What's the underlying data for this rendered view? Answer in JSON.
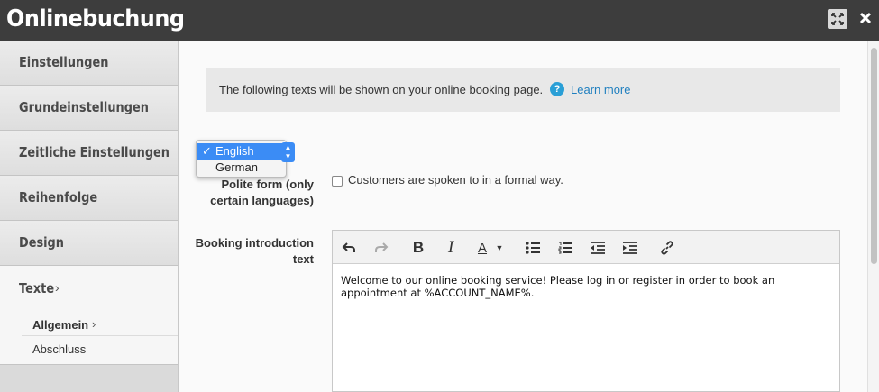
{
  "window": {
    "title": "Onlinebuchung"
  },
  "sidebar": {
    "items": [
      {
        "label": "Einstellungen"
      },
      {
        "label": "Grundeinstellungen"
      },
      {
        "label": "Zeitliche Einstellungen"
      },
      {
        "label": "Reihenfolge"
      },
      {
        "label": "Design"
      }
    ],
    "active": {
      "label": "Texte",
      "chevron": "›",
      "subitems": [
        {
          "label": "Allgemein",
          "chevron": "›"
        },
        {
          "label": "Abschluss"
        }
      ]
    }
  },
  "info": {
    "text": "The following texts will be shown on your online booking page.",
    "help_icon": "?",
    "link": "Learn more"
  },
  "language_select": {
    "options": [
      "English",
      "German"
    ],
    "selected": "English",
    "check": "✓"
  },
  "polite_form": {
    "label": "Polite form (only certain languages)",
    "checkbox_label": "Customers are spoken to in a formal way."
  },
  "intro": {
    "label": "Booking introduction text",
    "text": "Welcome to our online booking service! Please log in or register in order to book an appointment at %ACCOUNT_NAME%."
  },
  "toolbar": {
    "bold": "B",
    "italic": "I",
    "font_color": "A"
  },
  "colors": {
    "titlebar": "#3d3d3d",
    "accent": "#3b8cf5",
    "link": "#1f7fbf"
  }
}
